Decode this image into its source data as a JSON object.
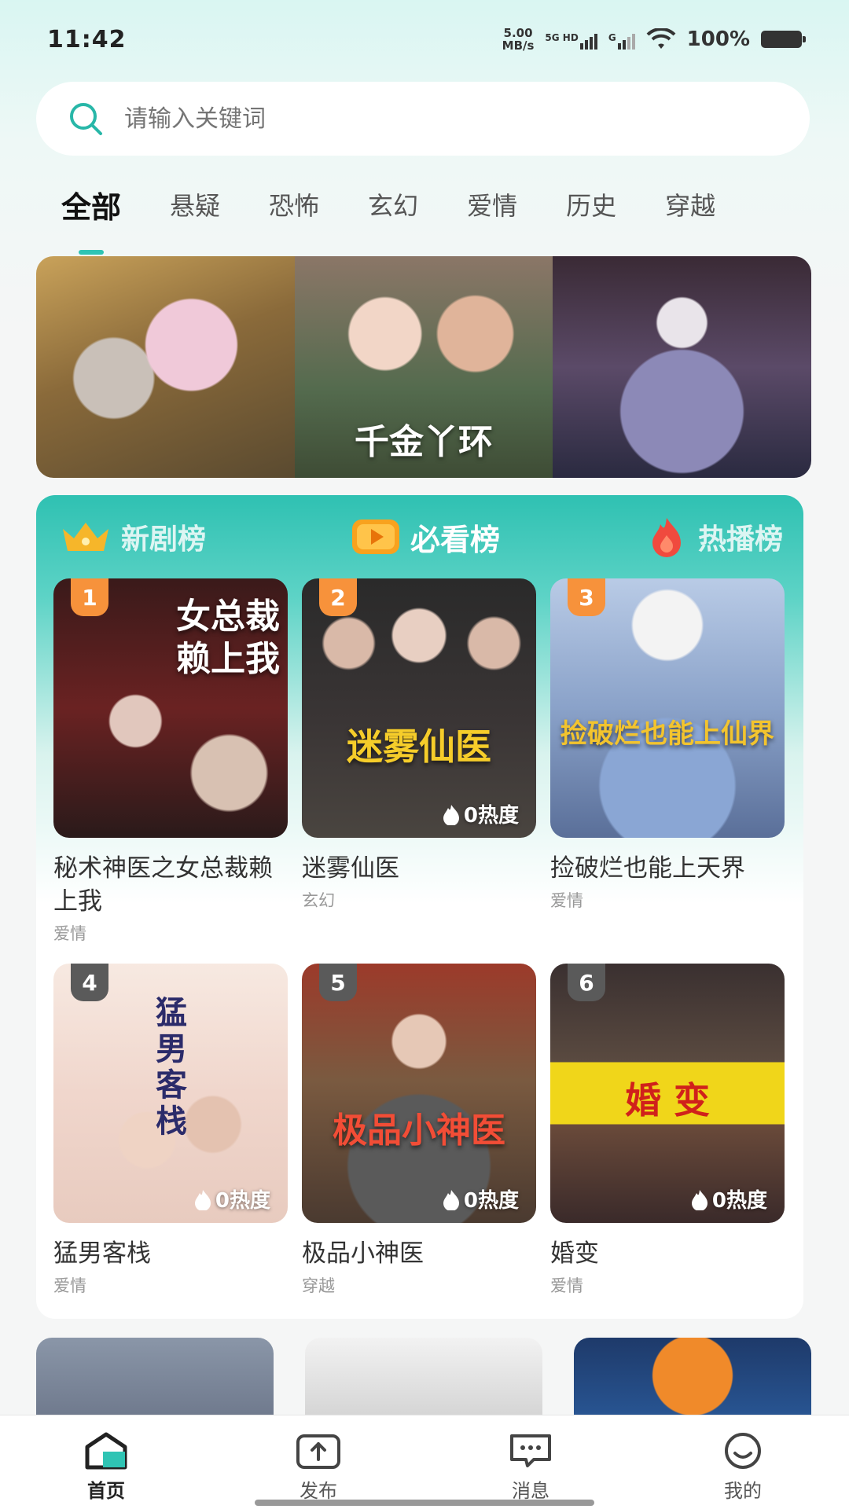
{
  "status": {
    "time": "11:42",
    "net_speed_value": "5.00",
    "net_speed_unit": "MB/s",
    "sim1_label": "5G HD",
    "sim2_label": "G",
    "battery": "100%"
  },
  "search": {
    "placeholder": "请输入关键词",
    "icon": "search-icon"
  },
  "tabs": [
    {
      "label": "全部",
      "active": true
    },
    {
      "label": "悬疑"
    },
    {
      "label": "恐怖"
    },
    {
      "label": "玄幻"
    },
    {
      "label": "爱情"
    },
    {
      "label": "历史"
    },
    {
      "label": "穿越"
    }
  ],
  "banner": {
    "captions": [
      "",
      "千金丫环",
      ""
    ]
  },
  "ranking": {
    "tabs": [
      {
        "label": "新剧榜",
        "icon": "crown-icon"
      },
      {
        "label": "必看榜",
        "icon": "play-icon",
        "active": true
      },
      {
        "label": "热播榜",
        "icon": "flame-icon"
      }
    ],
    "items": [
      {
        "rank": "1",
        "title": "秘术神医之女总裁赖上我",
        "genre": "爱情",
        "poster_text": "女总裁\n赖上我",
        "heat": ""
      },
      {
        "rank": "2",
        "title": "迷雾仙医",
        "genre": "玄幻",
        "poster_text": "迷雾仙医",
        "heat": "0热度"
      },
      {
        "rank": "3",
        "title": "捡破烂也能上天界",
        "genre": "爱情",
        "poster_text": "捡破烂也能上仙界",
        "heat": ""
      },
      {
        "rank": "4",
        "title": "猛男客栈",
        "genre": "爱情",
        "poster_text": "猛男客栈",
        "heat": "0热度"
      },
      {
        "rank": "5",
        "title": "极品小神医",
        "genre": "穿越",
        "poster_text": "极品小神医",
        "heat": "0热度"
      },
      {
        "rank": "6",
        "title": "婚变",
        "genre": "爱情",
        "poster_text": "婚 变",
        "heat": "0热度"
      }
    ]
  },
  "bottom_nav": [
    {
      "label": "首页",
      "icon": "home-icon",
      "active": true
    },
    {
      "label": "发布",
      "icon": "upload-icon"
    },
    {
      "label": "消息",
      "icon": "message-icon"
    },
    {
      "label": "我的",
      "icon": "profile-icon"
    }
  ]
}
